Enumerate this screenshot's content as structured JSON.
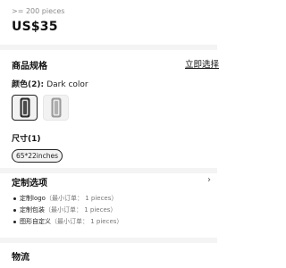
{
  "pricing": {
    "moq_text": ">= 200 pieces",
    "price": "US$35"
  },
  "specs": {
    "title": "商品规格",
    "select_link": "立即选择",
    "color_label_prefix": "颜色(2): ",
    "color_value": "Dark color",
    "swatches": [
      {
        "name": "Dark color",
        "selected": true,
        "color": "#2a2a2a"
      },
      {
        "name": "Light color",
        "selected": false,
        "color": "#9a9a9a"
      }
    ],
    "size_label": "尺寸(1)",
    "size_option": "65*22inches"
  },
  "customization": {
    "title": "定制选项",
    "items": [
      {
        "label": "定制logo",
        "min": "（最小订单： 1 pieces）"
      },
      {
        "label": "定制包装",
        "min": "（最小订单： 1 pieces）"
      },
      {
        "label": "图形自定义",
        "min": "（最小订单： 1 pieces）"
      }
    ]
  },
  "logistics": {
    "title": "物流"
  }
}
